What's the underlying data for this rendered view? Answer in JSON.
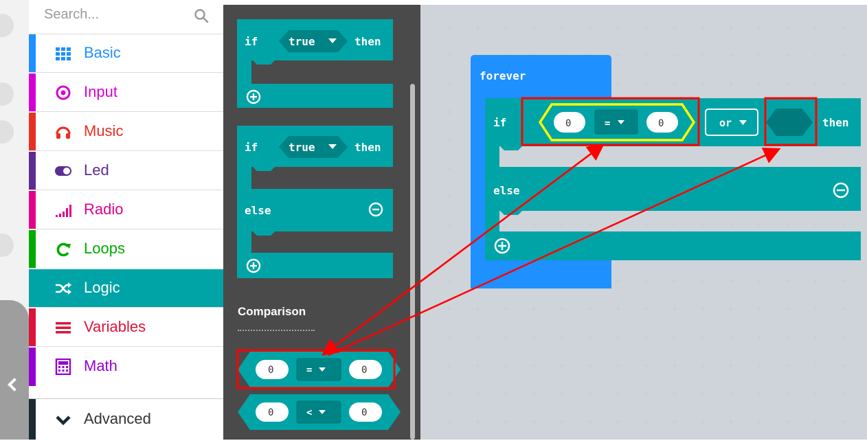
{
  "search": {
    "placeholder": "Search..."
  },
  "categories": [
    {
      "label": "Basic",
      "color": "#1e90ff",
      "icon": "grid-icon"
    },
    {
      "label": "Input",
      "color": "#d400d4",
      "icon": "target-icon"
    },
    {
      "label": "Music",
      "color": "#e63022",
      "icon": "headphones-icon"
    },
    {
      "label": "Led",
      "color": "#5c2d91",
      "icon": "toggle-icon"
    },
    {
      "label": "Radio",
      "color": "#e3008c",
      "icon": "signal-bars-icon"
    },
    {
      "label": "Loops",
      "color": "#00aa00",
      "icon": "loop-arrow-icon"
    },
    {
      "label": "Logic",
      "color": "#00a4a6",
      "icon": "shuffle-icon",
      "selected": true
    },
    {
      "label": "Variables",
      "color": "#dc143c",
      "icon": "list-lines-icon"
    },
    {
      "label": "Math",
      "color": "#9400d3",
      "icon": "calculator-icon"
    }
  ],
  "advanced": {
    "label": "Advanced",
    "icon": "chevron-down-icon"
  },
  "flyout": {
    "block1": {
      "if": "if",
      "cond": "true",
      "then": "then"
    },
    "block2": {
      "if": "if",
      "cond": "true",
      "then": "then",
      "else": "else"
    },
    "section_label": "Comparison",
    "compare_eq": {
      "left": "0",
      "op": "=",
      "right": "0"
    },
    "compare_lt": {
      "left": "0",
      "op": "<",
      "right": "0"
    }
  },
  "workspace": {
    "forever": "forever",
    "if_kw": "if",
    "cmp": {
      "left": "0",
      "op": "=",
      "right": "0"
    },
    "or_op": "or",
    "then_kw": "then",
    "else_kw": "else"
  },
  "colors": {
    "logic": "#00a4a6",
    "logic_dark": "#008385",
    "basic_blue": "#1e90ff",
    "highlight_yellow": "#ffff00",
    "annotation_red": "#ff0000"
  }
}
